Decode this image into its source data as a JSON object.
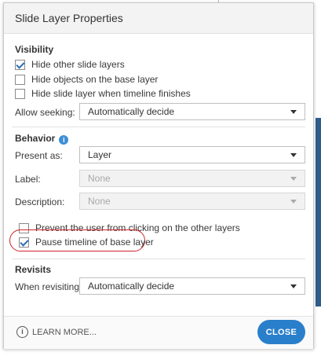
{
  "dialog": {
    "title": "Slide Layer Properties",
    "visibility": {
      "heading": "Visibility",
      "hide_other": {
        "label": "Hide other slide layers",
        "checked": true
      },
      "hide_objects": {
        "label": "Hide objects on the base layer",
        "checked": false
      },
      "hide_when_finished": {
        "label": "Hide slide layer when timeline finishes",
        "checked": false
      },
      "allow_seeking": {
        "label": "Allow seeking:",
        "value": "Automatically decide"
      }
    },
    "behavior": {
      "heading": "Behavior",
      "info_glyph": "i",
      "present_as": {
        "label": "Present as:",
        "value": "Layer"
      },
      "label_field": {
        "label": "Label:",
        "value": "None"
      },
      "description": {
        "label": "Description:",
        "value": "None"
      },
      "prevent_click": {
        "label": "Prevent the user from clicking on the other layers",
        "checked": false
      },
      "pause_timeline": {
        "label": "Pause timeline of base layer",
        "checked": true
      }
    },
    "revisits": {
      "heading": "Revisits",
      "when_revisiting": {
        "label": "When revisiting:",
        "value": "Automatically decide"
      }
    },
    "footer": {
      "learn_more": "LEARN MORE...",
      "learn_icon": "i",
      "close": "CLOSE"
    }
  },
  "colors": {
    "accent": "#2a7fcb",
    "highlight": "#d0232a",
    "info": "#3d8fd6"
  }
}
